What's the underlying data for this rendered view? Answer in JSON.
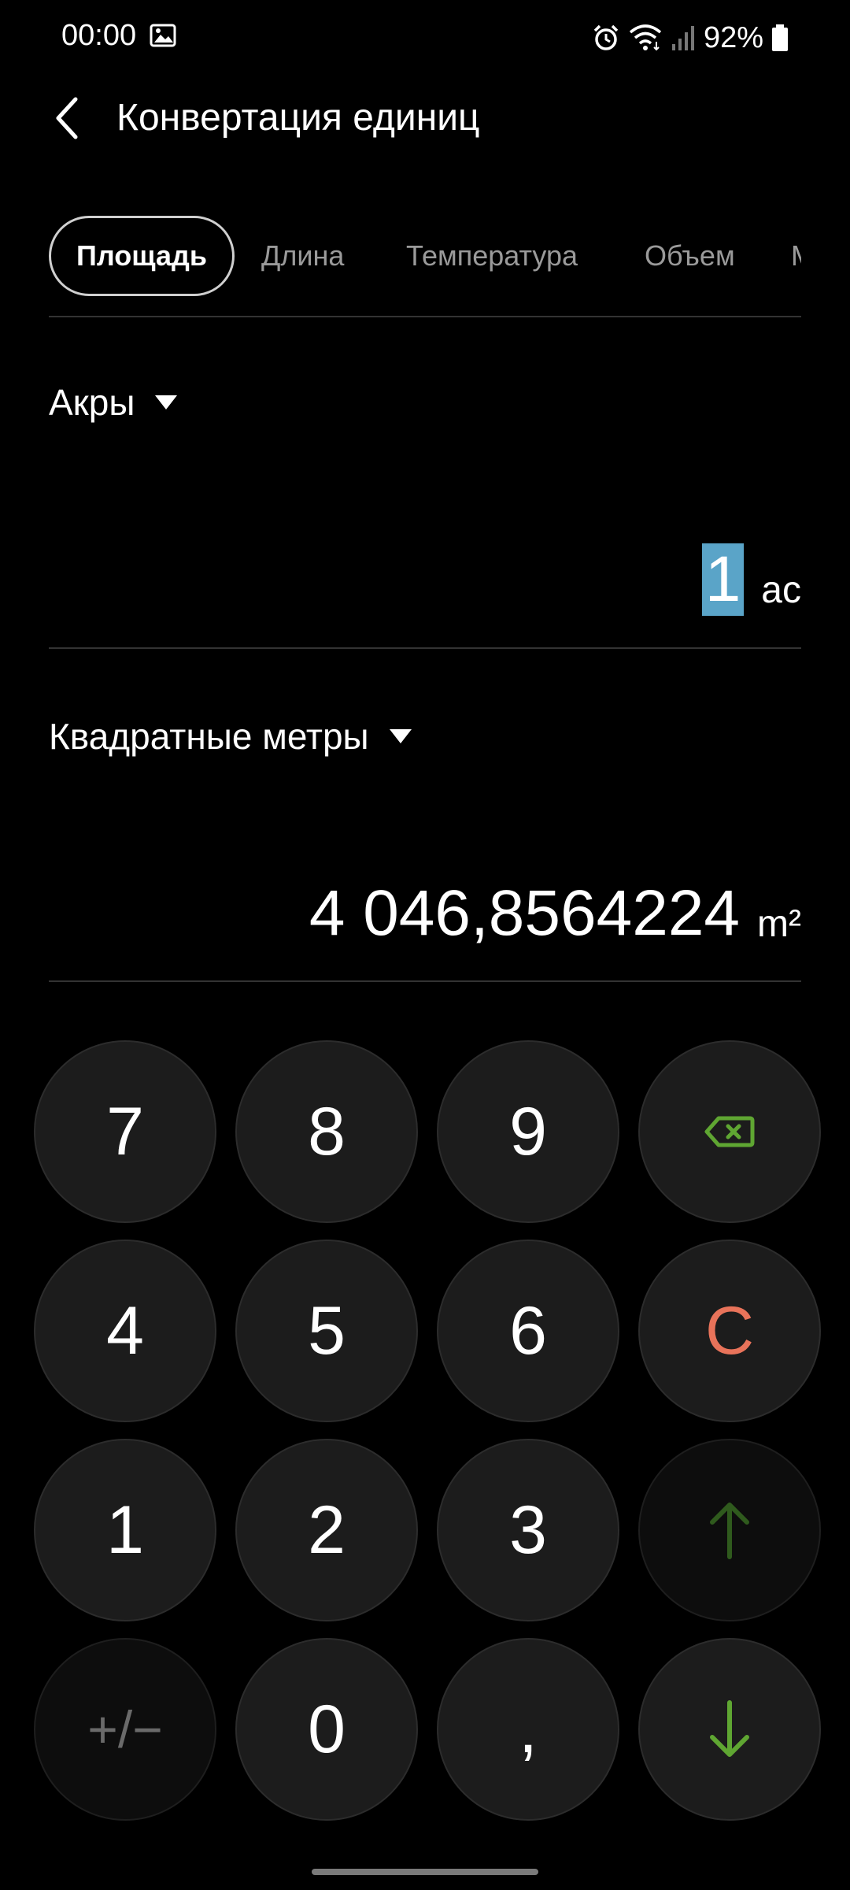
{
  "status_bar": {
    "time": "00:00",
    "battery_percent": "92%",
    "icons": [
      "gallery-icon",
      "alarm-icon",
      "wifi-icon",
      "signal-icon",
      "battery-icon"
    ]
  },
  "header": {
    "title": "Конвертация единиц",
    "back_icon": "chevron-left-icon"
  },
  "tabs": [
    {
      "label": "Площадь",
      "active": true
    },
    {
      "label": "Длина",
      "active": false
    },
    {
      "label": "Температура",
      "active": false
    },
    {
      "label": "Объем",
      "active": false
    },
    {
      "label": "М",
      "active": false
    }
  ],
  "from": {
    "unit_name": "Акры",
    "value": "1",
    "unit_symbol": "ac"
  },
  "to": {
    "unit_name": "Квадратные метры",
    "value": "4 046,8564224",
    "unit_symbol": "m²"
  },
  "keypad": {
    "rows": [
      [
        "7",
        "8",
        "9",
        "backspace"
      ],
      [
        "4",
        "5",
        "6",
        "C"
      ],
      [
        "1",
        "2",
        "3",
        "up"
      ],
      [
        "+/−",
        "0",
        ",",
        "down"
      ]
    ],
    "labels": {
      "k7": "7",
      "k8": "8",
      "k9": "9",
      "k4": "4",
      "k5": "5",
      "k6": "6",
      "k1": "1",
      "k2": "2",
      "k3": "3",
      "k0": "0",
      "comma": ",",
      "sign": "+/−",
      "clear": "C"
    }
  },
  "colors": {
    "background": "#000000",
    "key_background": "#1c1c1c",
    "selection": "#5aa4c8",
    "clear": "#e8735a",
    "accent_green": "#5fa632",
    "accent_green_dim": "#2f5a1d"
  }
}
